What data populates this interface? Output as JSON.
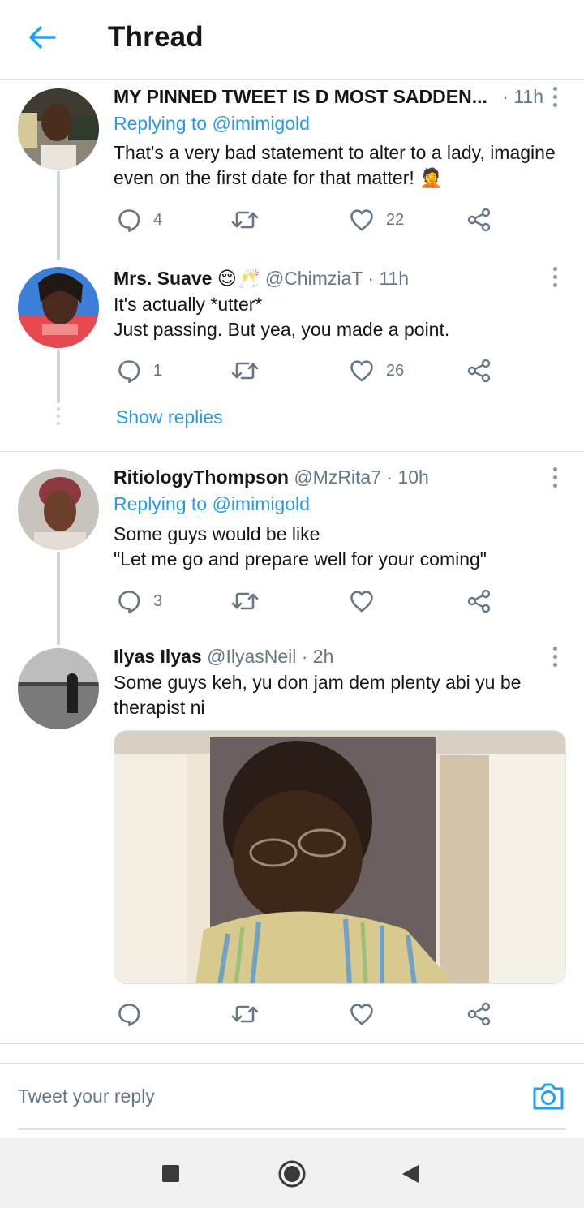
{
  "header": {
    "title": "Thread"
  },
  "tweets": [
    {
      "name": "MY PINNED TWEET IS D MOST SADDEN...",
      "handle": "",
      "time": "· 11h",
      "replying_prefix": "Replying to ",
      "replying_to": "@imimigold",
      "text": "That's a very bad statement to alter to a lady, imagine even on the first date for that matter! 🤦",
      "replies": "4",
      "retweets": "",
      "likes": "22"
    },
    {
      "name": "Mrs. Suave 😌🥂",
      "handle": "@ChimziaT",
      "time": "· 11h",
      "text": "It's actually *utter*\nJust passing. But yea, you made a point.",
      "replies": "1",
      "retweets": "",
      "likes": "26"
    },
    {
      "name": "RitiologyThompson",
      "handle": "@MzRita7",
      "time": "· 10h",
      "replying_prefix": "Replying to ",
      "replying_to": "@imimigold",
      "text": "Some guys would be like\n\"Let me go and prepare well for your coming\"",
      "replies": "3",
      "retweets": "",
      "likes": ""
    },
    {
      "name": "Ilyas Ilyas",
      "handle": "@IlyasNeil",
      "time": "· 2h",
      "text": "Some guys keh, yu don jam dem plenty abi yu be therapist ni",
      "replies": "",
      "retweets": "",
      "likes": ""
    }
  ],
  "show_replies": "Show replies",
  "reply_bar": {
    "placeholder": "Tweet your reply"
  },
  "colors": {
    "accent": "#1da1f2",
    "text": "#14171a",
    "muted": "#657786",
    "divider": "#dde3e8"
  },
  "icons": [
    "back-arrow-icon",
    "more-vertical-icon",
    "reply-icon",
    "retweet-icon",
    "like-icon",
    "share-icon",
    "camera-icon",
    "nav-square-icon",
    "nav-home-icon",
    "nav-back-icon"
  ]
}
